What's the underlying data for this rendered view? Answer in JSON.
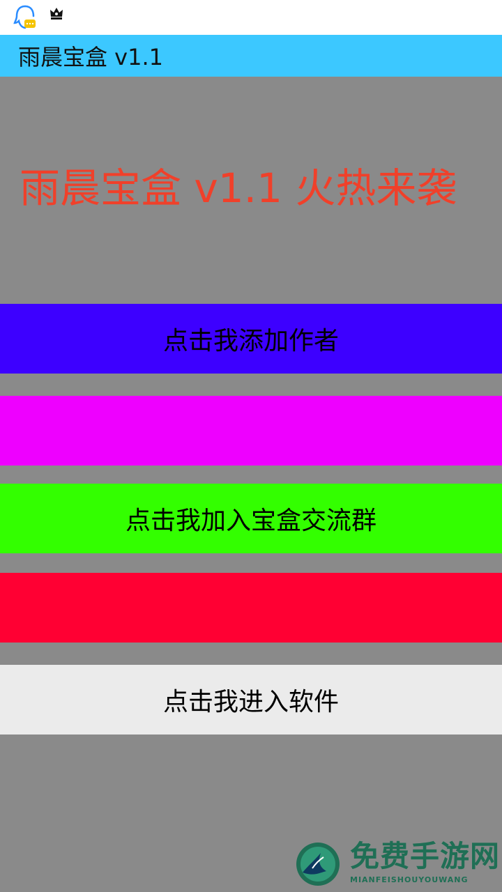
{
  "app": {
    "title": "雨晨宝盒 v1.1"
  },
  "headline": "雨晨宝盒 v1.1   火热来袭",
  "buttons": [
    {
      "label": "点击我添加作者",
      "color": "#3d00ff"
    },
    {
      "label": "",
      "color": "#ee00ff"
    },
    {
      "label": "点击我加入宝盒交流群",
      "color": "#33ff00"
    },
    {
      "label": "",
      "color": "#ff0033"
    },
    {
      "label": "点击我进入软件",
      "color": "#ebebeb"
    }
  ],
  "status_icons": [
    "qq-icon",
    "crown-icon"
  ],
  "watermark": {
    "text": "免费手游网",
    "sub": "MIANFEISHOUYOUWANG"
  },
  "colors": {
    "background": "#8a8a8a",
    "app_bar": "#3cc8ff",
    "headline": "#f0402a"
  }
}
